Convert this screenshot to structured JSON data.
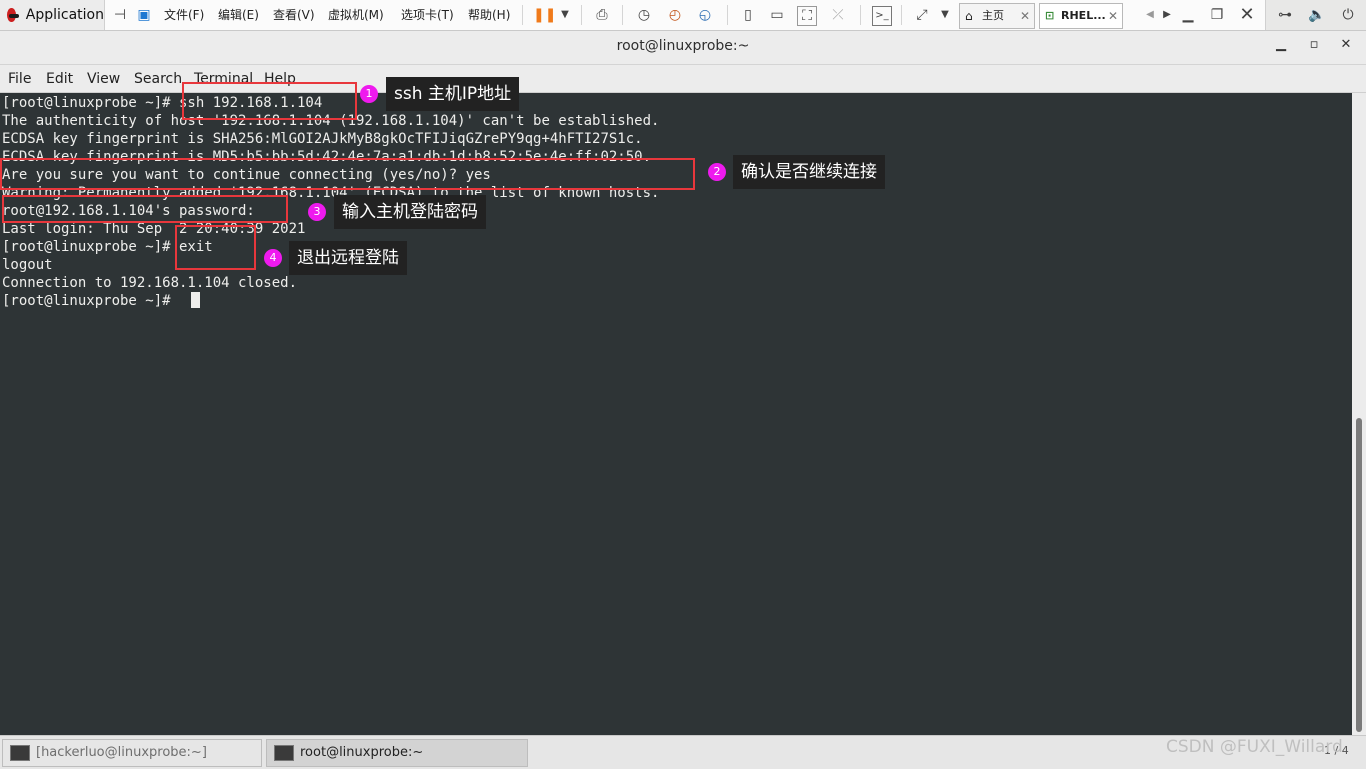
{
  "topbar": {
    "applications": "Application",
    "vmware_menu": [
      "文件(F)",
      "编辑(E)",
      "查看(V)",
      "虚拟机(M)",
      "选项卡(T)",
      "帮助(H)"
    ],
    "tabs": [
      {
        "label": "主页"
      },
      {
        "label": "RHEL..."
      }
    ]
  },
  "window": {
    "title": "root@linuxprobe:~",
    "buttons": {
      "minimize": "▁",
      "maximize": "▫",
      "close": "✕"
    }
  },
  "menubar": [
    "File",
    "Edit",
    "View",
    "Search",
    "Terminal",
    "Help"
  ],
  "terminal": {
    "lines": [
      "[root@linuxprobe ~]# ssh 192.168.1.104",
      "The authenticity of host '192.168.1.104 (192.168.1.104)' can't be established.",
      "ECDSA key fingerprint is SHA256:MlGOI2AJkMyB8gkOcTFIJiqGZrePY9qg+4hFTI27S1c.",
      "ECDSA key fingerprint is MD5:b5:bb:5d:42:4e:7a:a1:db:1d:b8:52:5e:4e:ff:02:50.",
      "Are you sure you want to continue connecting (yes/no)? yes",
      "Warning: Permanently added '192.168.1.104' (ECDSA) to the list of known hosts.",
      "root@192.168.1.104's password:",
      "Last login: Thu Sep  2 20:40:39 2021",
      "[root@linuxprobe ~]# exit",
      "logout",
      "Connection to 192.168.1.104 closed.",
      "[root@linuxprobe ~]# "
    ]
  },
  "annotations": [
    {
      "number": "1",
      "label": "ssh 主机IP地址"
    },
    {
      "number": "2",
      "label": "确认是否继续连接"
    },
    {
      "number": "3",
      "label": "输入主机登陆密码"
    },
    {
      "number": "4",
      "label": "退出远程登陆"
    }
  ],
  "taskbar": {
    "items": [
      {
        "label": "[hackerluo@linuxprobe:~]"
      },
      {
        "label": "root@linuxprobe:~"
      }
    ],
    "pager": "1 / 4",
    "watermark": "CSDN @FUXI_Willard"
  },
  "colors": {
    "terminal_bg": "#2e3436",
    "terminal_fg": "#eeeeec",
    "annotation_box": "#e8373c",
    "annotation_circle": "#ee1aee"
  }
}
